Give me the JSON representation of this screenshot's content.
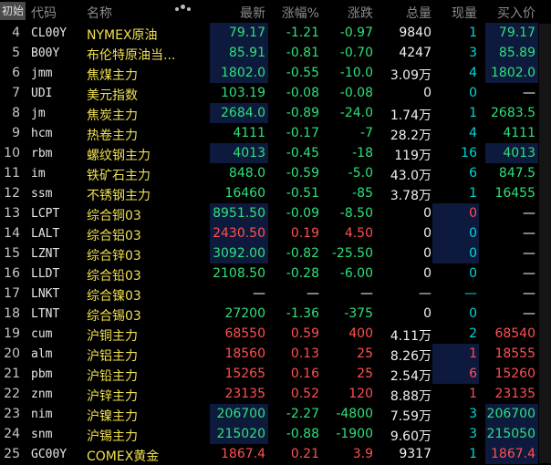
{
  "header": {
    "start_tab": "初始",
    "code": "代码",
    "name": "名称",
    "last": "最新",
    "pct": "涨幅%",
    "change": "涨跌",
    "volume": "总量",
    "now_vol": "现量",
    "bid": "买入价",
    "settings_icon": "gear-icon"
  },
  "colors": {
    "up": "#ff5050",
    "down": "#2ee07a",
    "flat": "#ffffff",
    "name": "#f0e050",
    "now_vol": "#00d8d8",
    "highlight_bg": "#0d1a3d"
  },
  "rows": [
    {
      "idx": "4",
      "code": "CL00Y",
      "name": "NYMEX原油",
      "last": "79.17",
      "pct": "-1.21",
      "chg": "-0.97",
      "vol": "9840",
      "now": "1",
      "bid": "79.17",
      "dir": "g",
      "bid_dir": "g",
      "hl": [
        1,
        0,
        1
      ]
    },
    {
      "idx": "5",
      "code": "B00Y",
      "name": "布伦特原油当...",
      "last": "85.91",
      "pct": "-0.81",
      "chg": "-0.70",
      "vol": "4247",
      "now": "3",
      "bid": "85.89",
      "dir": "g",
      "bid_dir": "g",
      "hl": [
        1,
        0,
        1
      ]
    },
    {
      "idx": "6",
      "code": "jmm",
      "name": "焦煤主力",
      "last": "1802.0",
      "pct": "-0.55",
      "chg": "-10.0",
      "vol": "3.09万",
      "now": "4",
      "bid": "1802.0",
      "dir": "g",
      "bid_dir": "g",
      "hl": [
        1,
        0,
        1
      ]
    },
    {
      "idx": "7",
      "code": "UDI",
      "name": "美元指数",
      "last": "103.19",
      "pct": "-0.08",
      "chg": "-0.08",
      "vol": "0",
      "now": "0",
      "bid": "—",
      "dir": "g",
      "bid_dir": "w",
      "hl": [
        0,
        0,
        0
      ]
    },
    {
      "idx": "8",
      "code": "jm",
      "name": "焦炭主力",
      "last": "2684.0",
      "pct": "-0.89",
      "chg": "-24.0",
      "vol": "1.74万",
      "now": "1",
      "bid": "2683.5",
      "dir": "g",
      "bid_dir": "g",
      "hl": [
        1,
        0,
        0
      ]
    },
    {
      "idx": "9",
      "code": "hcm",
      "name": "热卷主力",
      "last": "4111",
      "pct": "-0.17",
      "chg": "-7",
      "vol": "28.2万",
      "now": "4",
      "bid": "4111",
      "dir": "g",
      "bid_dir": "g",
      "hl": [
        0,
        0,
        0
      ]
    },
    {
      "idx": "10",
      "code": "rbm",
      "name": "螺纹钢主力",
      "last": "4013",
      "pct": "-0.45",
      "chg": "-18",
      "vol": "119万",
      "now": "16",
      "bid": "4013",
      "dir": "g",
      "bid_dir": "g",
      "hl": [
        1,
        0,
        1
      ]
    },
    {
      "idx": "11",
      "code": "im",
      "name": "铁矿石主力",
      "last": "848.0",
      "pct": "-0.59",
      "chg": "-5.0",
      "vol": "43.0万",
      "now": "6",
      "bid": "847.5",
      "dir": "g",
      "bid_dir": "g",
      "hl": [
        0,
        0,
        0
      ]
    },
    {
      "idx": "12",
      "code": "ssm",
      "name": "不锈钢主力",
      "last": "16460",
      "pct": "-0.51",
      "chg": "-85",
      "vol": "3.78万",
      "now": "1",
      "bid": "16455",
      "dir": "g",
      "bid_dir": "g",
      "hl": [
        0,
        0,
        0
      ]
    },
    {
      "idx": "13",
      "code": "LCPT",
      "name": "综合铜03",
      "last": "8951.50",
      "pct": "-0.09",
      "chg": "-8.50",
      "vol": "0",
      "now": "0",
      "bid": "—",
      "dir": "g",
      "bid_dir": "w",
      "hl": [
        1,
        1,
        0
      ],
      "now_dir": "r"
    },
    {
      "idx": "14",
      "code": "LALT",
      "name": "综合铝03",
      "last": "2430.50",
      "pct": "0.19",
      "chg": "4.50",
      "vol": "0",
      "now": "0",
      "bid": "—",
      "dir": "r",
      "bid_dir": "w",
      "hl": [
        1,
        1,
        0
      ]
    },
    {
      "idx": "15",
      "code": "LZNT",
      "name": "综合锌03",
      "last": "3092.00",
      "pct": "-0.82",
      "chg": "-25.50",
      "vol": "0",
      "now": "0",
      "bid": "—",
      "dir": "g",
      "bid_dir": "w",
      "hl": [
        1,
        1,
        0
      ]
    },
    {
      "idx": "16",
      "code": "LLDT",
      "name": "综合铅03",
      "last": "2108.50",
      "pct": "-0.28",
      "chg": "-6.00",
      "vol": "0",
      "now": "0",
      "bid": "—",
      "dir": "g",
      "bid_dir": "w",
      "hl": [
        0,
        0,
        0
      ]
    },
    {
      "idx": "17",
      "code": "LNKT",
      "name": "综合镍03",
      "last": "—",
      "pct": "—",
      "chg": "—",
      "vol": "—",
      "now": "—",
      "bid": "—",
      "dir": "w",
      "bid_dir": "w",
      "hl": [
        0,
        0,
        0
      ]
    },
    {
      "idx": "18",
      "code": "LTNT",
      "name": "综合锡03",
      "last": "27200",
      "pct": "-1.36",
      "chg": "-375",
      "vol": "0",
      "now": "0",
      "bid": "—",
      "dir": "g",
      "bid_dir": "w",
      "hl": [
        0,
        0,
        0
      ]
    },
    {
      "idx": "19",
      "code": "cum",
      "name": "沪铜主力",
      "last": "68550",
      "pct": "0.59",
      "chg": "400",
      "vol": "4.11万",
      "now": "2",
      "bid": "68540",
      "dir": "r",
      "bid_dir": "r",
      "hl": [
        0,
        0,
        0
      ]
    },
    {
      "idx": "20",
      "code": "alm",
      "name": "沪铝主力",
      "last": "18560",
      "pct": "0.13",
      "chg": "25",
      "vol": "8.26万",
      "now": "1",
      "bid": "18555",
      "dir": "r",
      "bid_dir": "r",
      "hl": [
        0,
        1,
        0
      ],
      "now_dir": "r"
    },
    {
      "idx": "21",
      "code": "pbm",
      "name": "沪铅主力",
      "last": "15265",
      "pct": "0.16",
      "chg": "25",
      "vol": "2.54万",
      "now": "6",
      "bid": "15260",
      "dir": "r",
      "bid_dir": "r",
      "hl": [
        0,
        1,
        0
      ],
      "now_dir": "r"
    },
    {
      "idx": "22",
      "code": "znm",
      "name": "沪锌主力",
      "last": "23135",
      "pct": "0.52",
      "chg": "120",
      "vol": "8.88万",
      "now": "1",
      "bid": "23135",
      "dir": "r",
      "bid_dir": "r",
      "hl": [
        0,
        0,
        0
      ],
      "now_dir": "r"
    },
    {
      "idx": "23",
      "code": "nim",
      "name": "沪镍主力",
      "last": "206700",
      "pct": "-2.27",
      "chg": "-4800",
      "vol": "7.59万",
      "now": "3",
      "bid": "206700",
      "dir": "g",
      "bid_dir": "g",
      "hl": [
        1,
        0,
        1
      ]
    },
    {
      "idx": "24",
      "code": "snm",
      "name": "沪锡主力",
      "last": "215020",
      "pct": "-0.88",
      "chg": "-1900",
      "vol": "9.60万",
      "now": "3",
      "bid": "215050",
      "dir": "g",
      "bid_dir": "g",
      "hl": [
        1,
        0,
        1
      ]
    },
    {
      "idx": "25",
      "code": "GC00Y",
      "name": "COMEX黄金",
      "last": "1867.4",
      "pct": "0.21",
      "chg": "3.9",
      "vol": "9317",
      "now": "1",
      "bid": "1867.4",
      "dir": "r",
      "bid_dir": "r",
      "hl": [
        0,
        0,
        1
      ]
    }
  ]
}
